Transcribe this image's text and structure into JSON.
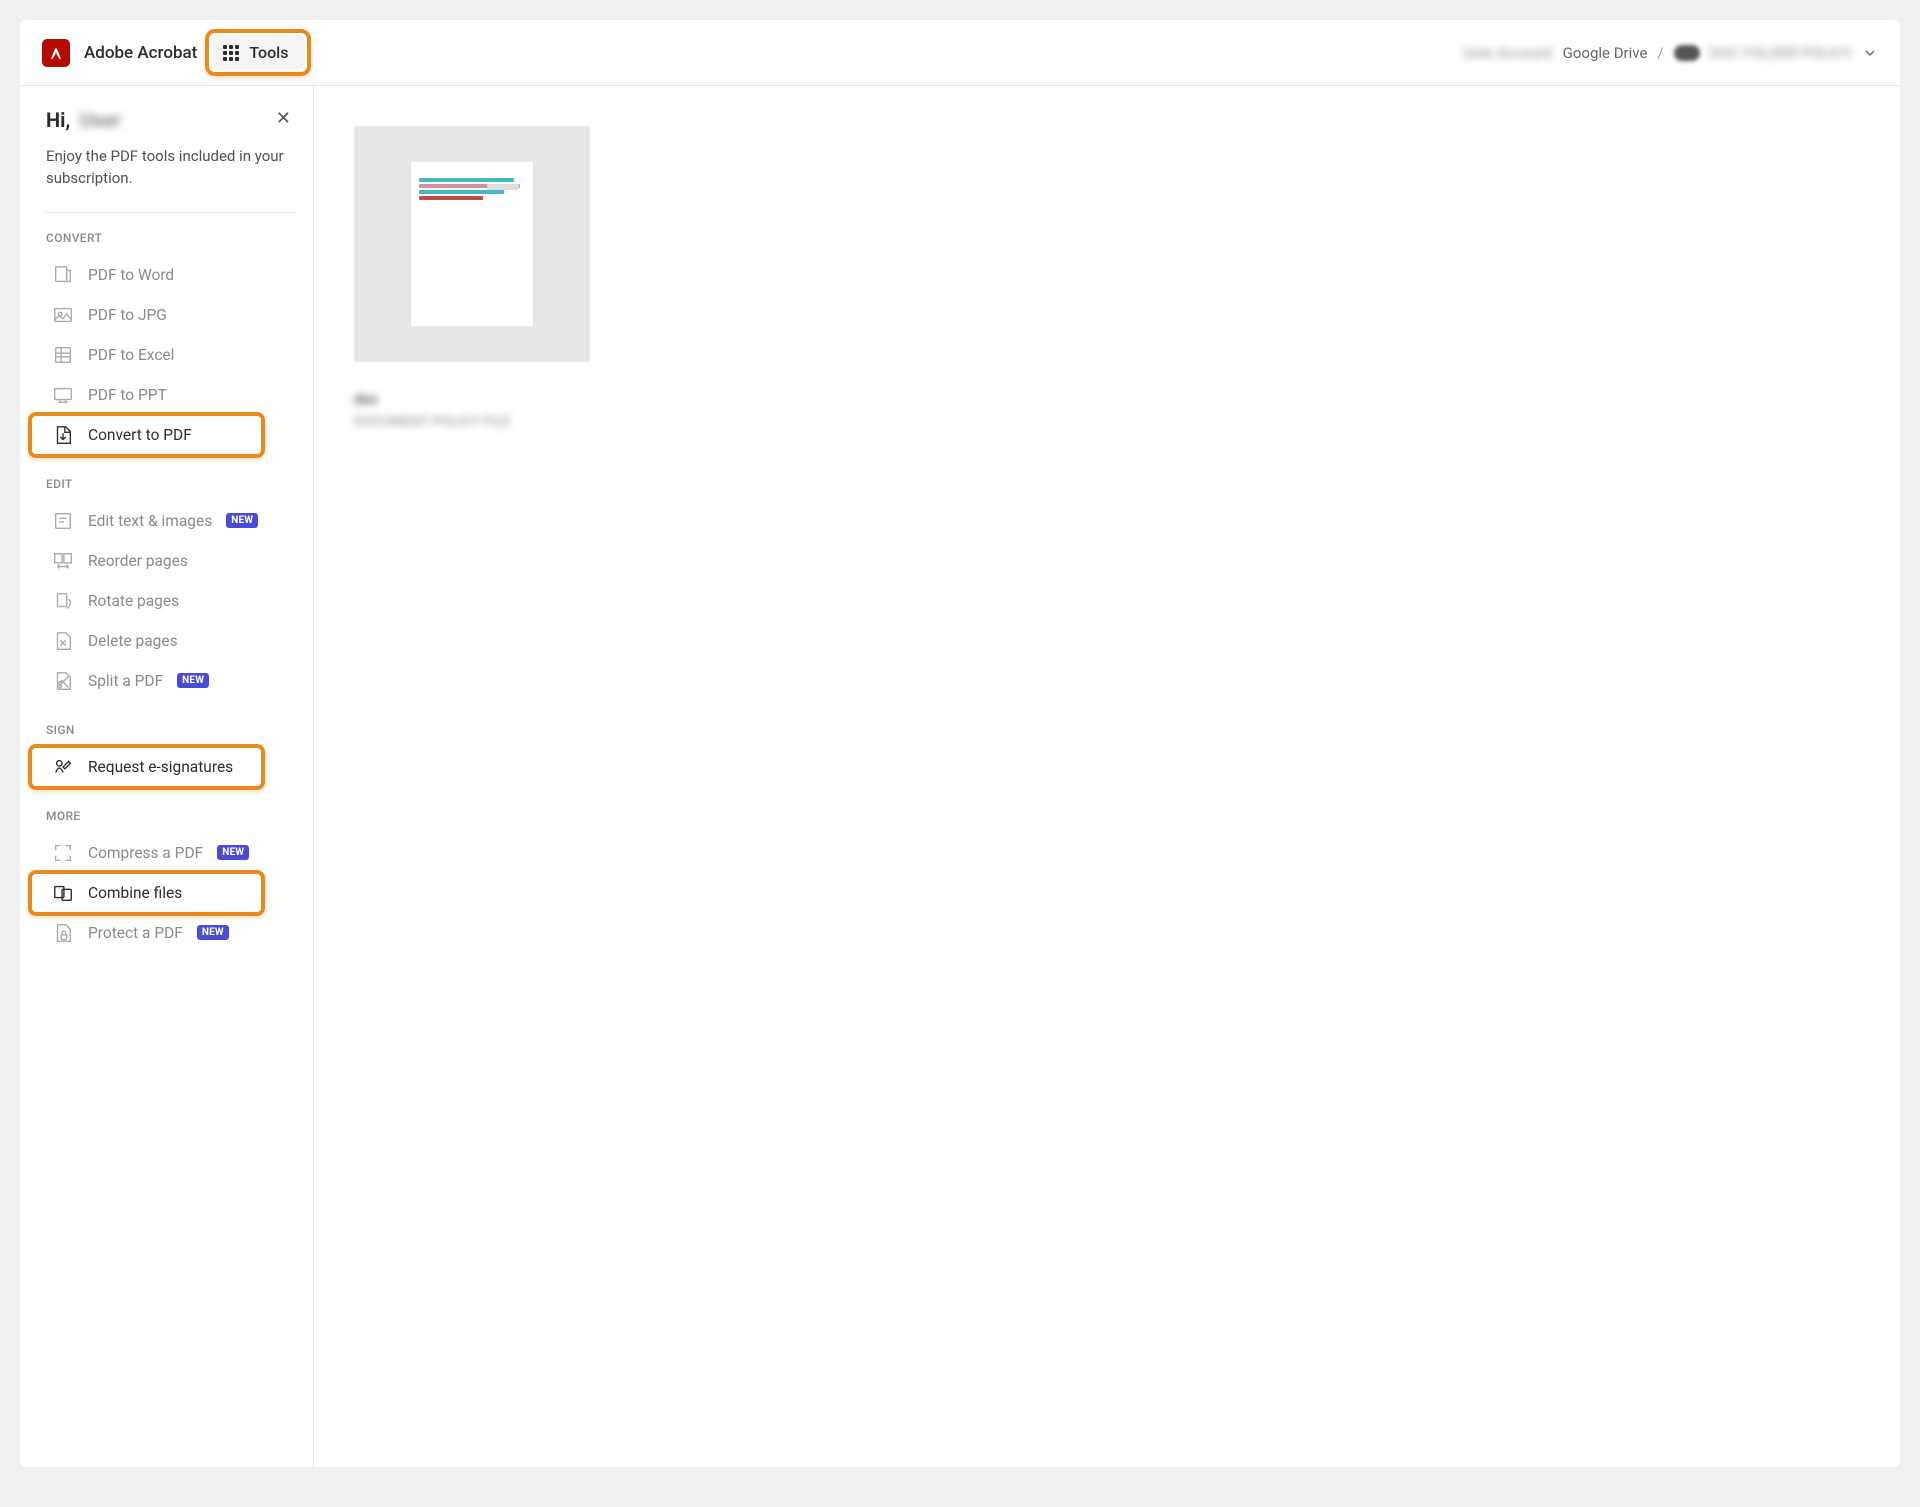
{
  "header": {
    "app_title": "Adobe Acrobat",
    "tools_label": "Tools",
    "breadcrumb": {
      "owner_blur": "User Account",
      "drive": "Google Drive",
      "folder_blur": "DOC FOLDER POLICY"
    }
  },
  "sidebar": {
    "greeting_prefix": "Hi,",
    "greeting_name_blur": "User",
    "subtext": "Enjoy the PDF tools included in your subscription.",
    "sections": {
      "convert": {
        "label": "CONVERT",
        "items": [
          {
            "label": "PDF to Word"
          },
          {
            "label": "PDF to JPG"
          },
          {
            "label": "PDF to Excel"
          },
          {
            "label": "PDF to PPT"
          },
          {
            "label": "Convert to PDF",
            "highlighted": true
          }
        ]
      },
      "edit": {
        "label": "EDIT",
        "items": [
          {
            "label": "Edit text & images",
            "badge": "NEW"
          },
          {
            "label": "Reorder pages"
          },
          {
            "label": "Rotate pages"
          },
          {
            "label": "Delete pages"
          },
          {
            "label": "Split a PDF",
            "badge": "NEW"
          }
        ]
      },
      "sign": {
        "label": "SIGN",
        "items": [
          {
            "label": "Request e-signatures",
            "highlighted": true
          }
        ]
      },
      "more": {
        "label": "MORE",
        "items": [
          {
            "label": "Compress a PDF",
            "badge": "NEW"
          },
          {
            "label": "Combine files",
            "highlighted": true
          },
          {
            "label": "Protect a PDF",
            "badge": "NEW"
          }
        ]
      }
    }
  },
  "main": {
    "thumbnail": {
      "caption_line1_blur": "doc",
      "caption_line2_blur": "DOCUMENT POLICY FILE"
    }
  }
}
